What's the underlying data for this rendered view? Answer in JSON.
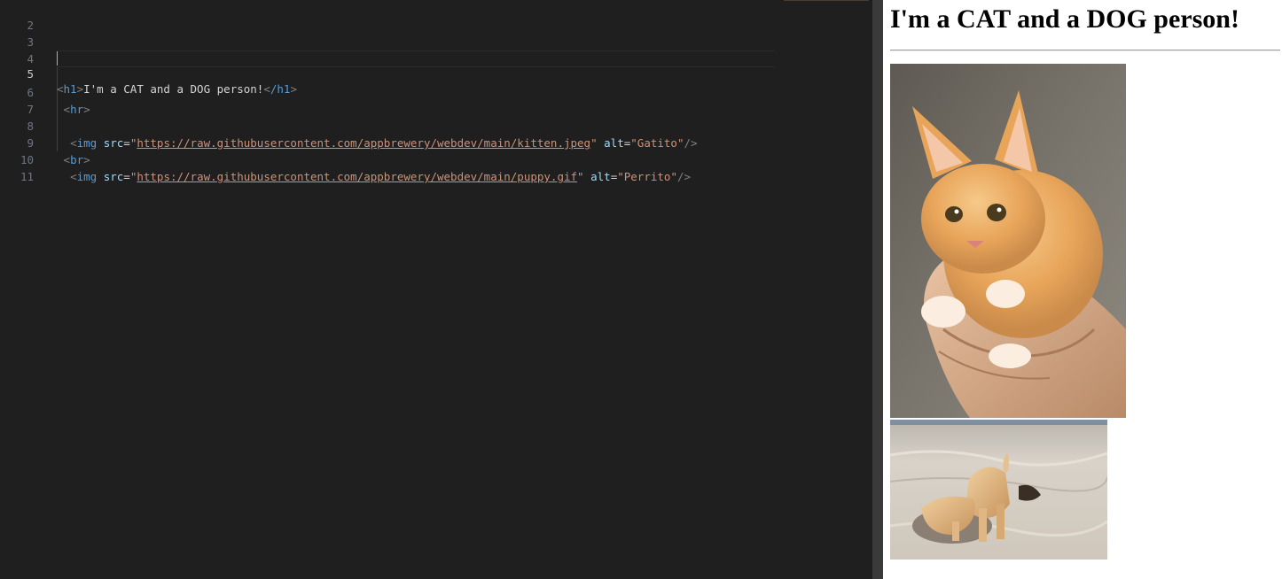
{
  "editor": {
    "lines": [
      {
        "number": "2"
      },
      {
        "number": "3"
      },
      {
        "number": "4"
      },
      {
        "number": "5"
      },
      {
        "number": "6"
      },
      {
        "number": "7"
      },
      {
        "number": "8"
      },
      {
        "number": "9"
      },
      {
        "number": "10"
      },
      {
        "number": "11"
      }
    ],
    "code": {
      "h1_open": "h1",
      "h1_text": "I'm a CAT and a DOG person!",
      "h1_close": "/h1",
      "hr": "hr",
      "img": "img",
      "attr_src": "src",
      "attr_alt": "alt",
      "kitten_url": "https://raw.githubusercontent.com/appbrewery/webdev/main/kitten.jpeg",
      "kitten_alt": "Gatito",
      "br": "br",
      "puppy_url": "https://raw.githubusercontent.com/appbrewery/webdev/main/puppy.gif",
      "puppy_alt": "Perrito"
    }
  },
  "preview": {
    "heading": "I'm a CAT and a DOG person!",
    "kitten_alt": "Gatito",
    "puppy_alt": "Perrito"
  }
}
